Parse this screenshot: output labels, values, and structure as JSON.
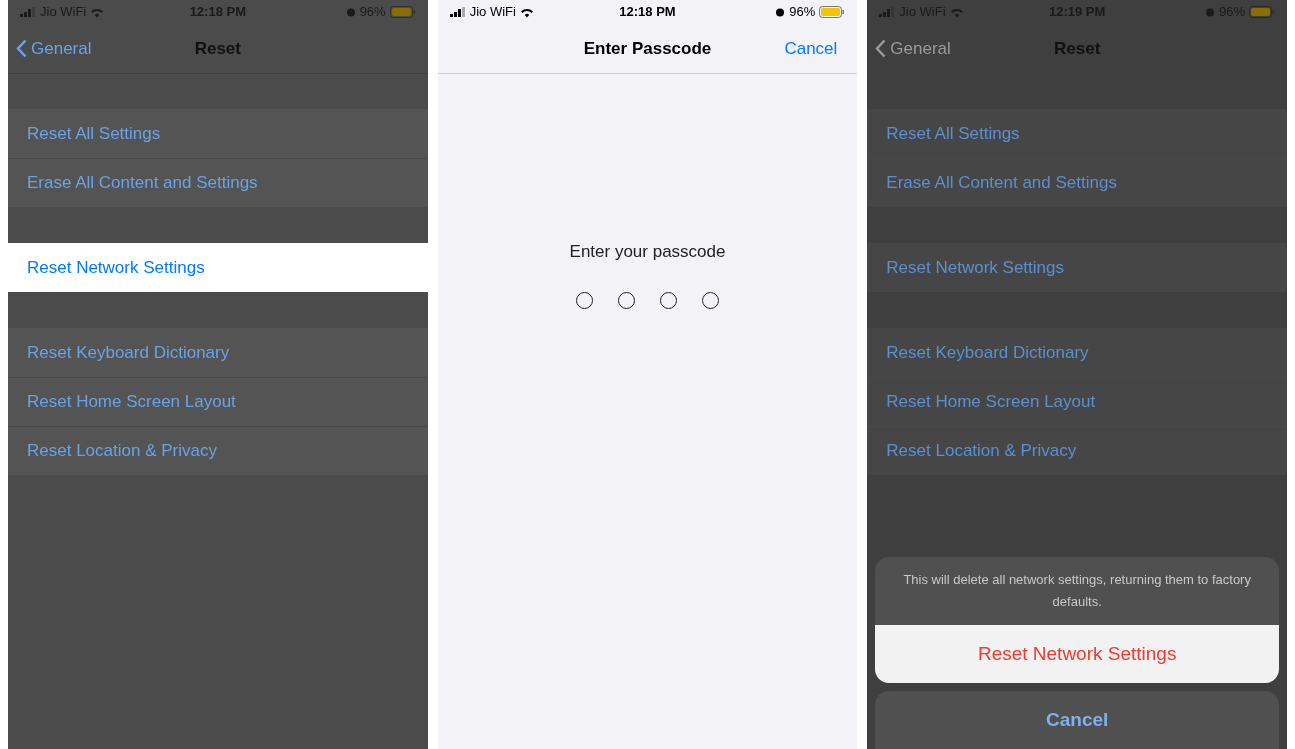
{
  "screens": [
    {
      "kind": "settings",
      "dimmed": true,
      "status_bar": {
        "carrier": "Jio WiFi",
        "time": "12:18 PM",
        "battery": "96%"
      },
      "nav": {
        "back": "General",
        "title": "Reset"
      },
      "groups": [
        [
          {
            "label": "Reset All Settings",
            "selected": false
          },
          {
            "label": "Erase All Content and Settings",
            "selected": false
          }
        ],
        [
          {
            "label": "Reset Network Settings",
            "selected": true
          }
        ],
        [
          {
            "label": "Reset Keyboard Dictionary",
            "selected": false
          },
          {
            "label": "Reset Home Screen Layout",
            "selected": false
          },
          {
            "label": "Reset Location & Privacy",
            "selected": false
          }
        ]
      ]
    },
    {
      "kind": "passcode",
      "dimmed": false,
      "status_bar": {
        "carrier": "Jio WiFi",
        "time": "12:18 PM",
        "battery": "96%"
      },
      "nav": {
        "title": "Enter Passcode",
        "action": "Cancel"
      },
      "prompt": "Enter your passcode",
      "dots": [
        {
          "filled": false
        },
        {
          "filled": false
        },
        {
          "filled": false
        },
        {
          "filled": false
        }
      ]
    },
    {
      "kind": "settings",
      "dimmed": true,
      "status_bar": {
        "carrier": "Jio WiFi",
        "time": "12:19 PM",
        "battery": "96%"
      },
      "nav": {
        "back": "General",
        "title": "Reset"
      },
      "groups": [
        [
          {
            "label": "Reset All Settings",
            "selected": false
          },
          {
            "label": "Erase All Content and Settings",
            "selected": false
          }
        ],
        [
          {
            "label": "Reset Network Settings",
            "selected": false
          }
        ],
        [
          {
            "label": "Reset Keyboard Dictionary",
            "selected": false
          },
          {
            "label": "Reset Home Screen Layout",
            "selected": false
          },
          {
            "label": "Reset Location & Privacy",
            "selected": false
          }
        ]
      ],
      "action_sheet": {
        "message": "This will delete all network settings, returning them to factory defaults.",
        "action": "Reset Network Settings",
        "cancel": "Cancel"
      }
    }
  ]
}
